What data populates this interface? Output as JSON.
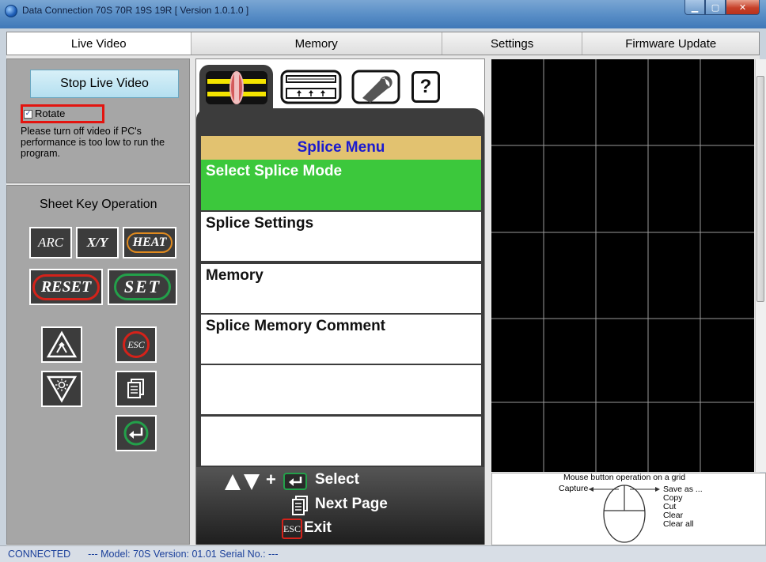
{
  "window": {
    "title": "Data Connection 70S 70R 19S 19R   [ Version 1.0.1.0 ]",
    "controls": [
      "minimize-icon",
      "maximize-icon",
      "close-icon"
    ]
  },
  "tabs": [
    {
      "label": "Live Video",
      "active": true
    },
    {
      "label": "Memory",
      "active": false
    },
    {
      "label": "Settings",
      "active": false
    },
    {
      "label": "Firmware Update",
      "active": false
    }
  ],
  "live_video": {
    "stop_button": "Stop Live Video",
    "rotate_label": "Rotate",
    "rotate_checked": true,
    "warning": "Please turn off video if PC's performance is too low to run the program."
  },
  "sheet_keys": {
    "title": "Sheet Key Operation",
    "arc": "ARC",
    "xy": "X/Y",
    "heat": "HEAT",
    "reset": "RESET",
    "set": "SET",
    "esc": "ESC"
  },
  "splice_menu": {
    "header": "Splice Menu",
    "items": [
      {
        "label": "Select Splice Mode",
        "selected": true
      },
      {
        "label": "Splice Settings",
        "selected": false
      },
      {
        "label": "Memory",
        "selected": false
      },
      {
        "label": "Splice Memory Comment",
        "selected": false
      },
      {
        "label": "",
        "selected": false
      },
      {
        "label": "",
        "selected": false
      }
    ],
    "help": {
      "select": "Select",
      "next_page": "Next Page",
      "exit": "Exit",
      "plus": "+",
      "esc": "ESC"
    },
    "icon_tabs": [
      "splice-icon",
      "heater-icon",
      "wrench-icon",
      "help-icon"
    ],
    "help_tab_glyph": "?"
  },
  "mouse_help": {
    "title": "Mouse button operation on a grid",
    "left": "Capture",
    "right": [
      "Save as ...",
      "Copy",
      "Cut",
      "Clear",
      "Clear all"
    ]
  },
  "status": {
    "connection": "CONNECTED",
    "details": "---  Model: 70S   Version: 01.01   Serial No.:                ---"
  },
  "colors": {
    "selected_item": "#3cc83c",
    "menu_header_bg": "#e2c270",
    "menu_header_text": "#1a1ad0",
    "highlight_box": "#e3140f"
  }
}
